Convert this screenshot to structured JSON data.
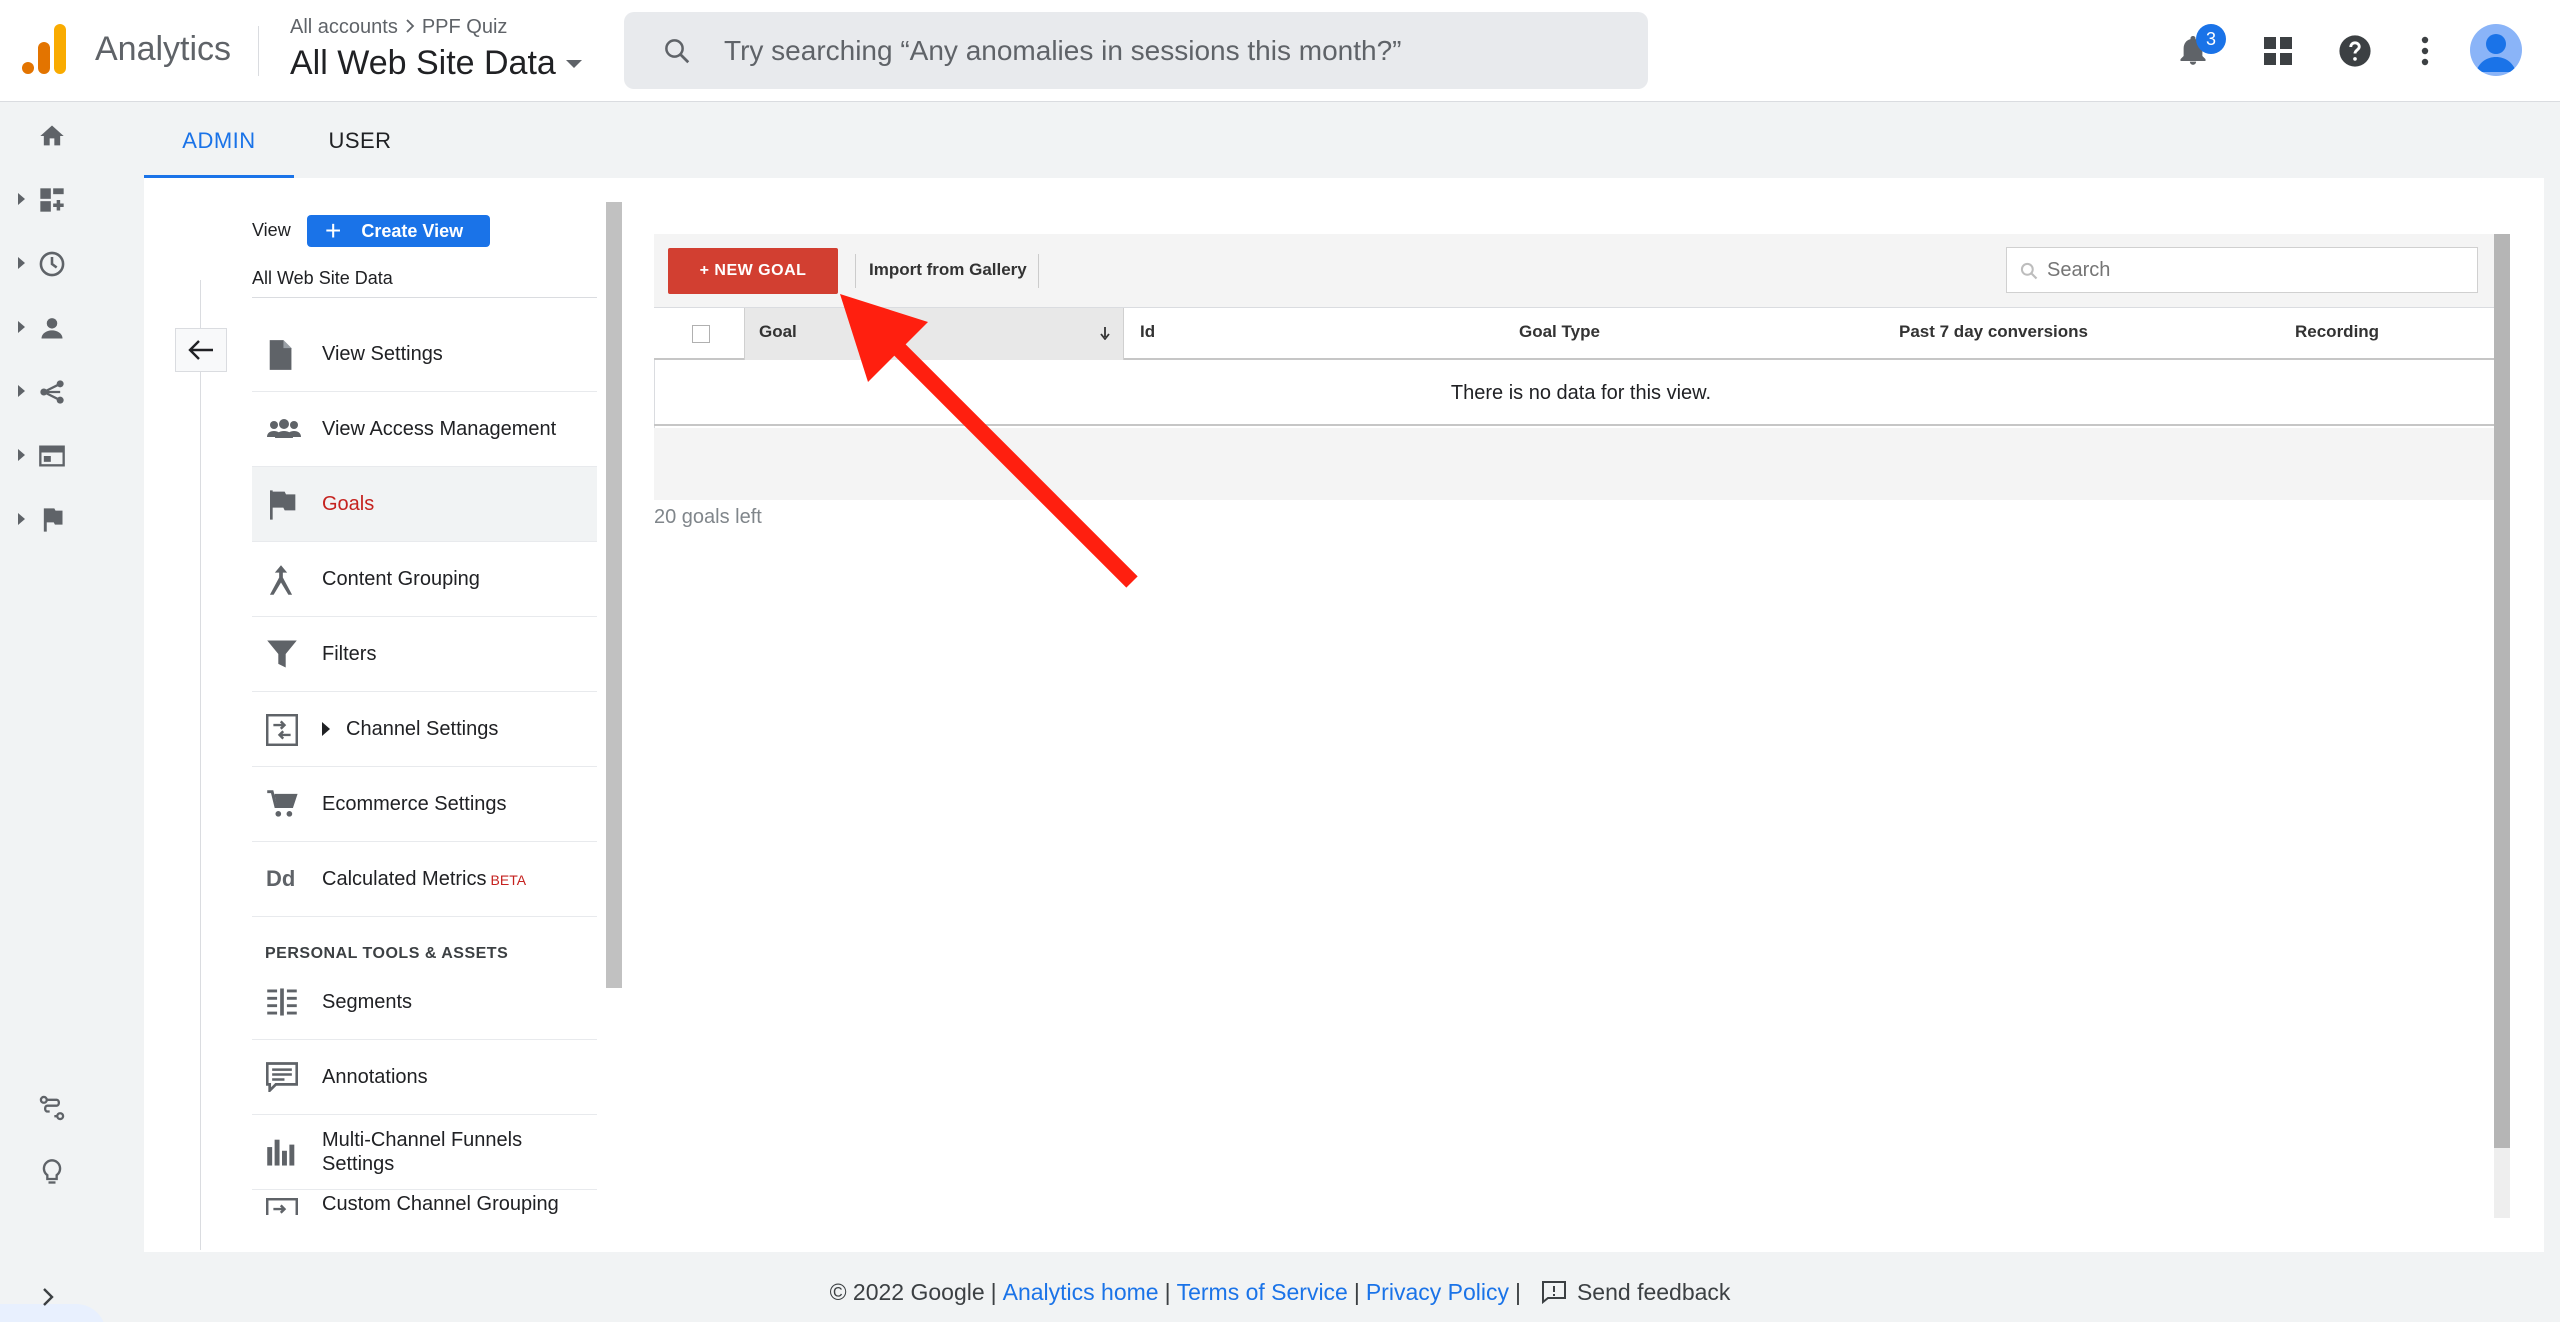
{
  "app": {
    "brand": "Analytics",
    "breadcrumb": [
      "All accounts",
      "PPF Quiz"
    ],
    "property": "All Web Site Data",
    "search_placeholder": "Try searching “Any anomalies in sessions this month?”",
    "notifications_count": "3"
  },
  "tabs": [
    {
      "label": "ADMIN",
      "active": true
    },
    {
      "label": "USER",
      "active": false
    }
  ],
  "view": {
    "label": "View",
    "create_button": "Create View",
    "name": "All Web Site Data"
  },
  "menu": [
    {
      "label": "View Settings",
      "icon": "document-icon"
    },
    {
      "label": "View Access Management",
      "icon": "people-icon"
    },
    {
      "label": "Goals",
      "icon": "flag-icon",
      "selected": true
    },
    {
      "label": "Content Grouping",
      "icon": "grouping-icon"
    },
    {
      "label": "Filters",
      "icon": "filter-icon"
    },
    {
      "label": "Channel Settings",
      "icon": "channel-icon"
    },
    {
      "label": "Ecommerce Settings",
      "icon": "cart-icon"
    },
    {
      "label": "Calculated Metrics",
      "icon": "dd-icon",
      "badge": "BETA"
    }
  ],
  "personal_section": {
    "heading": "PERSONAL TOOLS & ASSETS",
    "items": [
      {
        "label": "Segments",
        "icon": "segments-icon"
      },
      {
        "label": "Annotations",
        "icon": "annotation-icon"
      },
      {
        "label": "Multi-Channel Funnels Settings",
        "icon": "bars-icon"
      },
      {
        "label": "Custom Channel Grouping",
        "icon": "channel-icon"
      }
    ]
  },
  "goals_table": {
    "new_goal": "+ NEW GOAL",
    "import": "Import from Gallery",
    "search_placeholder": "Search",
    "columns": [
      "Goal",
      "Id",
      "Goal Type",
      "Past 7 day conversions",
      "Recording"
    ],
    "empty_message": "There is no data for this view.",
    "goals_left": "20 goals left"
  },
  "footer": {
    "copyright": "© 2022 Google",
    "links": [
      "Analytics home",
      "Terms of Service",
      "Privacy Policy"
    ],
    "feedback": "Send feedback"
  },
  "colors": {
    "accent": "#1a73e8",
    "new_goal": "#d23f31",
    "selected_text": "#c5221f",
    "arrow": "#ff1f0f"
  }
}
